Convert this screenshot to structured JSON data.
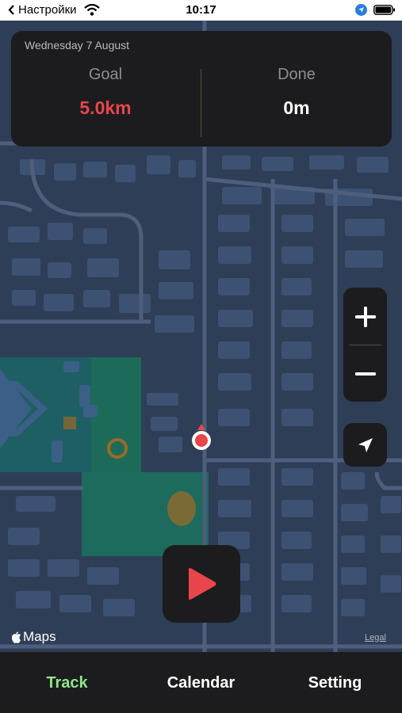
{
  "status_bar": {
    "back_label": "Настройки",
    "time": "10:17",
    "icons": [
      "wifi-icon",
      "location-arrow-icon",
      "battery-icon"
    ]
  },
  "info_card": {
    "date": "Wednesday 7 August",
    "goal_label": "Goal",
    "goal_value": "5.0km",
    "done_label": "Done",
    "done_value": "0m"
  },
  "map_controls": {
    "zoom_in_icon": "plus-icon",
    "zoom_out_icon": "minus-icon",
    "locate_icon": "location-arrow-icon"
  },
  "play_button": {
    "icon": "play-icon"
  },
  "map_attribution": {
    "maps_label": "Maps",
    "legal_label": "Legal"
  },
  "tab_bar": {
    "tabs": [
      {
        "label": "Track",
        "active": true
      },
      {
        "label": "Calendar",
        "active": false
      },
      {
        "label": "Setting",
        "active": false
      }
    ]
  },
  "colors": {
    "accent_red": "#e8464a",
    "active_tab": "#8ee68a",
    "panel_bg": "#1c1c1e",
    "map_bg": "#2f3e57",
    "park_green": "#1f6b5f"
  }
}
